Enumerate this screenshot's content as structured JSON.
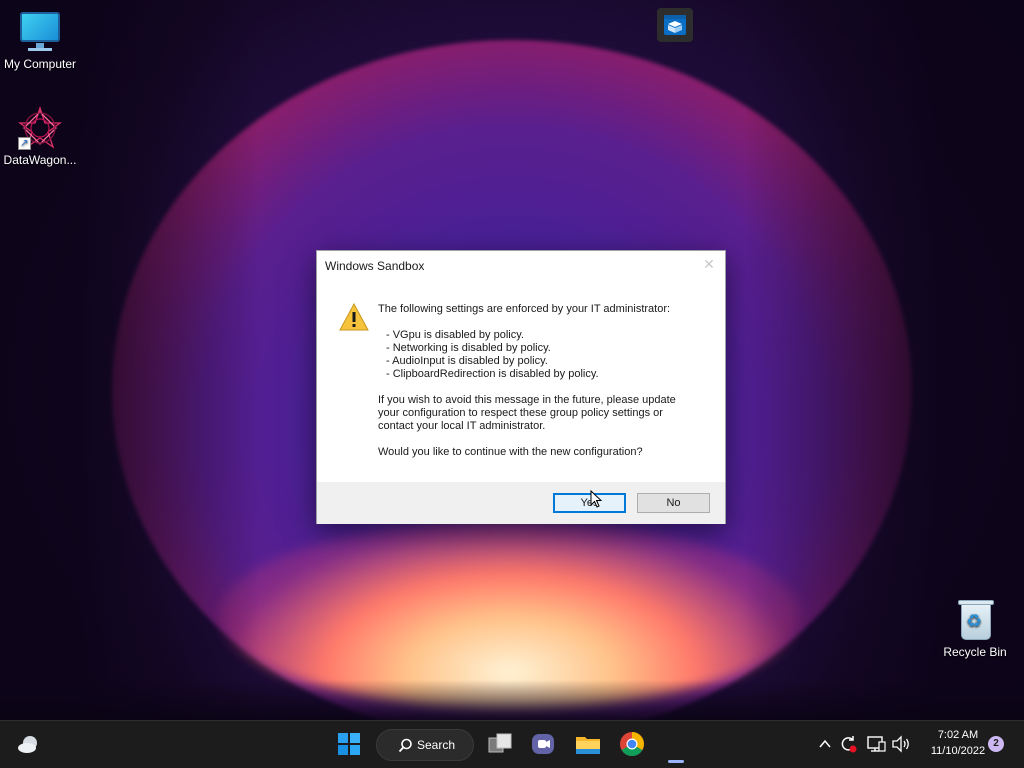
{
  "desktop": {
    "icons": [
      {
        "label": "My Computer",
        "icon": "monitor-icon"
      },
      {
        "label": "DataWagon...",
        "icon": "datawagon-shortcut-icon"
      },
      {
        "label": "Recycle Bin",
        "icon": "recycle-bin-icon"
      }
    ]
  },
  "dialog": {
    "title": "Windows Sandbox",
    "close_glyph": "✕",
    "intro": "The following settings are enforced by your IT administrator:",
    "items": [
      "- VGpu is disabled by policy.",
      "- Networking is disabled by policy.",
      "- AudioInput is disabled by policy.",
      "- ClipboardRedirection is disabled by policy."
    ],
    "advice_lines": [
      "If you wish to avoid this message in the future, please update",
      "your configuration to respect these group policy settings or",
      "contact your local IT administrator."
    ],
    "question": "Would you like to continue with the new configuration?",
    "yes_label": "Yes",
    "no_label": "No"
  },
  "taskbar": {
    "search_label": "Search",
    "time": "7:02 AM",
    "date": "11/10/2022",
    "notification_count": "2",
    "apps": [
      "start-icon",
      "search-icon",
      "task-view-icon",
      "teams-chat-icon",
      "file-explorer-icon",
      "chrome-icon",
      "sandbox-icon"
    ],
    "tray": [
      "chevron-up-icon",
      "sync-icon",
      "network-icon",
      "volume-icon"
    ]
  },
  "colors": {
    "accent": "#0078d7",
    "taskbar_bg": "#1c1c1c",
    "dialog_footer": "#f0f0f0",
    "warning": "#f6c33c"
  }
}
